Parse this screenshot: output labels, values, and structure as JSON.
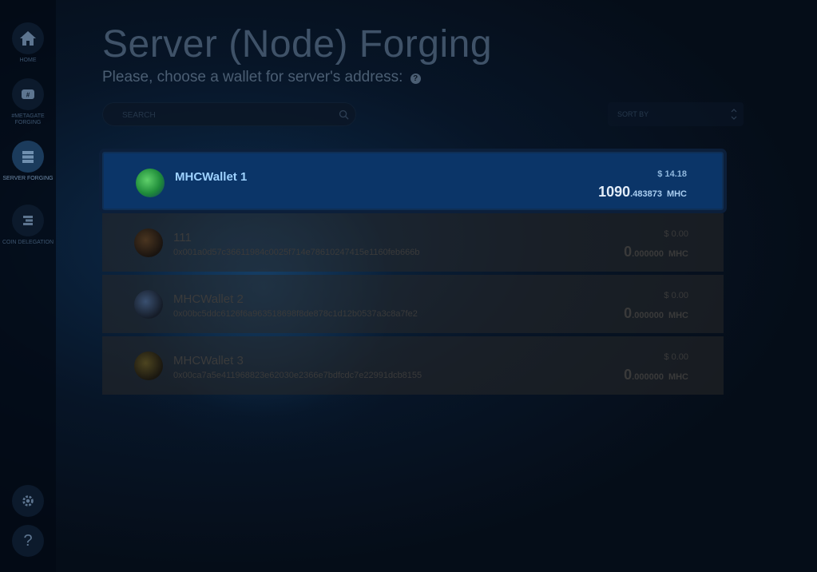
{
  "sidebar": {
    "items": [
      {
        "label": "HOME",
        "icon": "home-icon"
      },
      {
        "label": "#METAGATE FORGING",
        "icon": "metagate-icon"
      },
      {
        "label": "SERVER FORGING",
        "icon": "server-icon",
        "active": true
      },
      {
        "label": "COIN DELEGATION",
        "icon": "delegation-icon"
      }
    ],
    "bottom": [
      {
        "icon": "gear-icon"
      },
      {
        "label": "?",
        "icon": "help-icon"
      }
    ]
  },
  "header": {
    "title": "Server (Node) Forging",
    "subtitle": "Please, choose a wallet for server's address:",
    "help_mark": "?"
  },
  "search": {
    "placeholder": "SEARCH"
  },
  "sort": {
    "label": "SORT BY"
  },
  "wallets": [
    {
      "name": "MHCWallet 1",
      "address": "",
      "usd": "$ 14.18",
      "balance_int": "1090",
      "balance_dec": ".483873",
      "currency": "MHC",
      "selected": true,
      "avatar_color": "#1f8c3a"
    },
    {
      "name": "111",
      "address": "0x001a0d57c36611984c0025f714e78610247415e1160feb666b",
      "usd": "$ 0.00",
      "balance_int": "0",
      "balance_dec": ".000000",
      "currency": "MHC",
      "avatar_color": "#3b2a18"
    },
    {
      "name": "MHCWallet 2",
      "address": "0x00bc5ddc6126f6a963518698f8de878c1d12b0537a3c8a7fe2",
      "usd": "$ 0.00",
      "balance_int": "0",
      "balance_dec": ".000000",
      "currency": "MHC",
      "avatar_color": "#2a3a55"
    },
    {
      "name": "MHCWallet 3",
      "address": "0x00ca7a5e411968823e62030e2366e7bdfcdc7e22991dcb8155",
      "usd": "$ 0.00",
      "balance_int": "0",
      "balance_dec": ".000000",
      "currency": "MHC",
      "avatar_color": "#3d3a1a"
    }
  ]
}
